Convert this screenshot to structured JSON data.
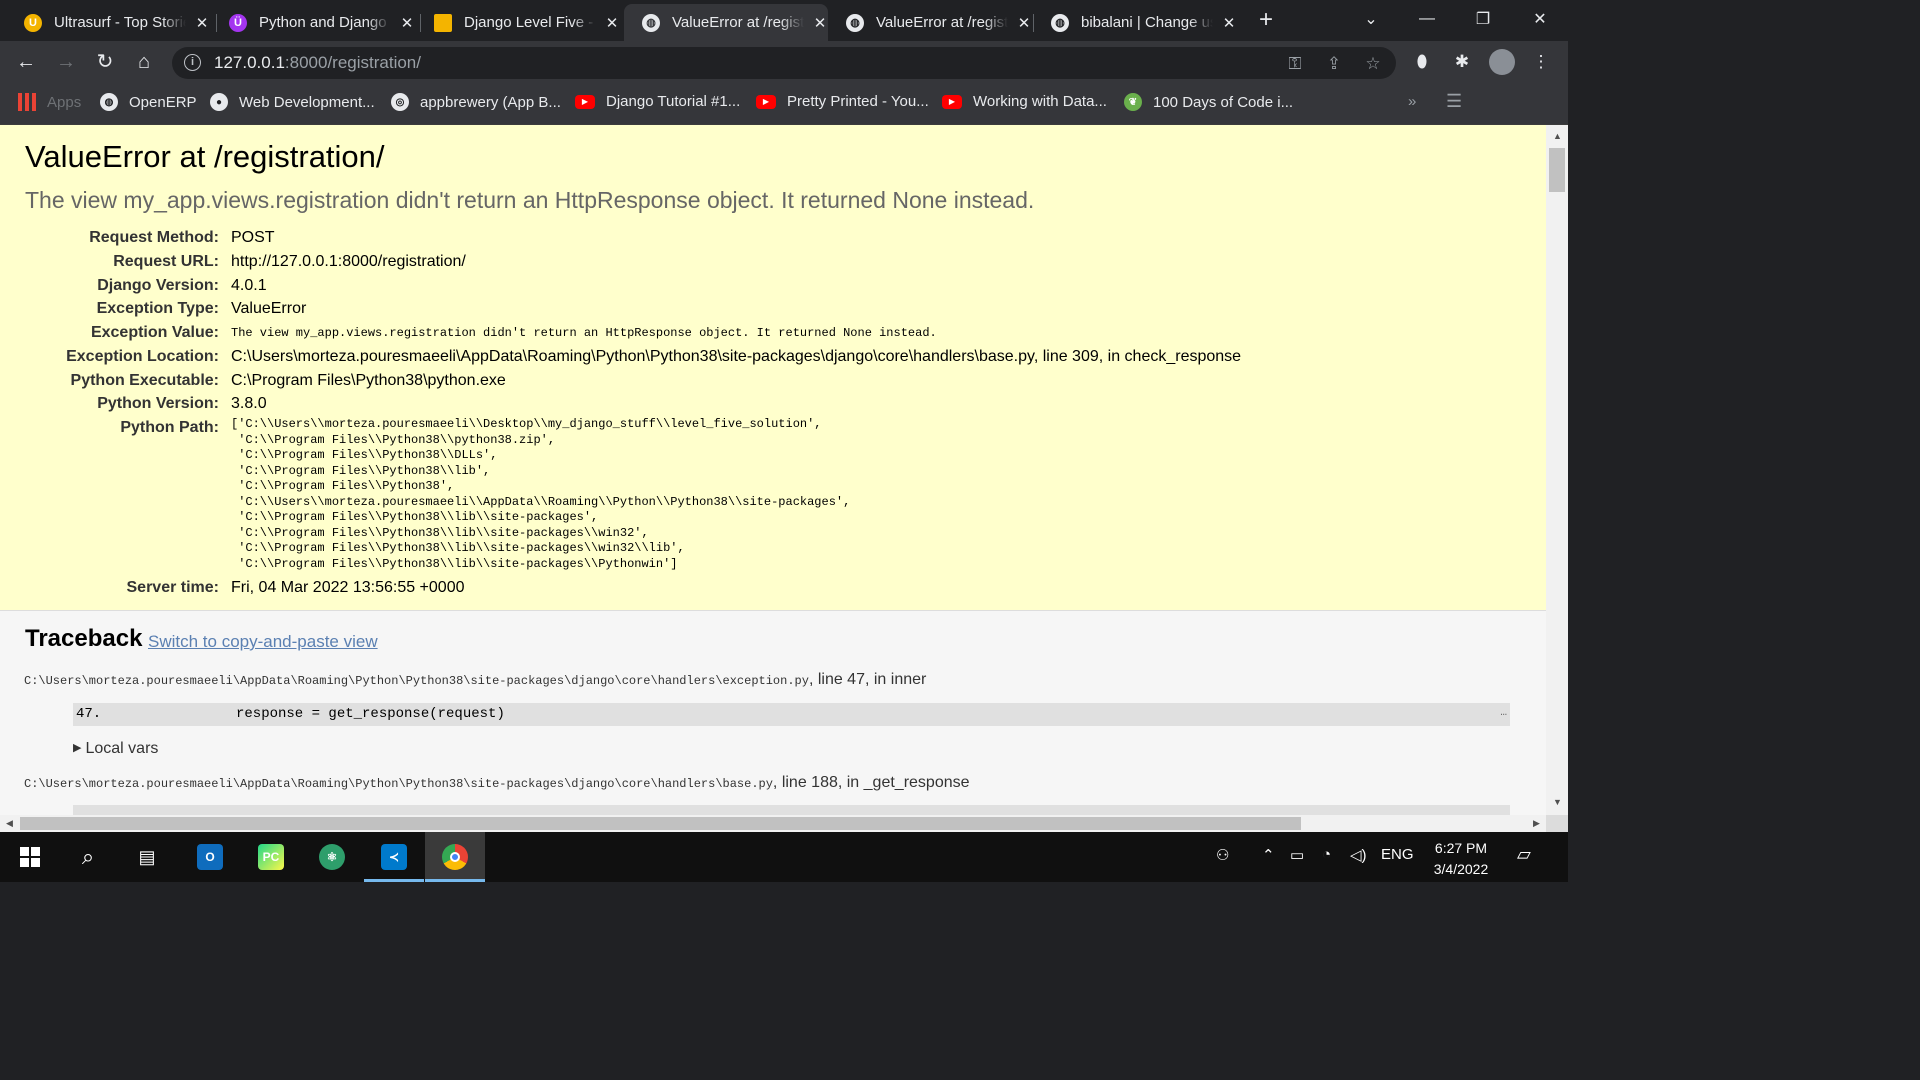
{
  "browser": {
    "tabs": [
      {
        "title": "Ultrasurf - Top Stories",
        "favicon": "ultrasurf-icon",
        "color": "#f4b400"
      },
      {
        "title": "Python and Django Full Stack",
        "favicon": "udemy-icon",
        "color": "#a435f0"
      },
      {
        "title": "Django Level Five - Google Slides",
        "favicon": "slides-icon",
        "color": "#f4b400"
      },
      {
        "title": "ValueError at /registration/",
        "favicon": "globe-icon",
        "color": "#e8eaed"
      },
      {
        "title": "ValueError at /registration/",
        "favicon": "globe-icon",
        "color": "#e8eaed"
      },
      {
        "title": "bibalani | Change user",
        "favicon": "globe-icon",
        "color": "#e8eaed"
      }
    ],
    "active_tab": 3,
    "url_host": "127.0.0.1",
    "url_rest": ":8000/registration/",
    "bookmarks": [
      {
        "label": "Apps",
        "icon": "apps-grid-icon"
      },
      {
        "label": "OpenERP",
        "icon": "globe-icon"
      },
      {
        "label": "Web Development...",
        "icon": "web-dev-icon"
      },
      {
        "label": "appbrewery (App B...",
        "icon": "appbrewery-icon"
      },
      {
        "label": "Django Tutorial #1...",
        "icon": "youtube-icon"
      },
      {
        "label": "Pretty Printed - You...",
        "icon": "youtube-icon"
      },
      {
        "label": "Working with Data...",
        "icon": "youtube-icon"
      },
      {
        "label": "100 Days of Code i...",
        "icon": "leaf-icon"
      }
    ]
  },
  "page": {
    "title": "ValueError at /registration/",
    "subtitle": "The view my_app.views.registration didn't return an HttpResponse object. It returned None instead.",
    "meta": [
      {
        "key": "Request Method:",
        "value": "POST"
      },
      {
        "key": "Request URL:",
        "value": "http://127.0.0.1:8000/registration/"
      },
      {
        "key": "Django Version:",
        "value": "4.0.1"
      },
      {
        "key": "Exception Type:",
        "value": "ValueError"
      },
      {
        "key": "Exception Value:",
        "value": "The view my_app.views.registration didn't return an HttpResponse object. It returned None instead."
      },
      {
        "key": "Exception Location:",
        "value": "C:\\Users\\morteza.pouresmaeeli\\AppData\\Roaming\\Python\\Python38\\site-packages\\django\\core\\handlers\\base.py, line 309, in check_response"
      },
      {
        "key": "Python Executable:",
        "value": "C:\\Program Files\\Python38\\python.exe"
      },
      {
        "key": "Python Version:",
        "value": "3.8.0"
      },
      {
        "key": "Python Path:",
        "value": "['C:\\\\Users\\\\morteza.pouresmaeeli\\\\Desktop\\\\my_django_stuff\\\\level_five_solution',\n 'C:\\\\Program Files\\\\Python38\\\\python38.zip',\n 'C:\\\\Program Files\\\\Python38\\\\DLLs',\n 'C:\\\\Program Files\\\\Python38\\\\lib',\n 'C:\\\\Program Files\\\\Python38',\n 'C:\\\\Users\\\\morteza.pouresmaeeli\\\\AppData\\\\Roaming\\\\Python\\\\Python38\\\\site-packages',\n 'C:\\\\Program Files\\\\Python38\\\\lib\\\\site-packages',\n 'C:\\\\Program Files\\\\Python38\\\\lib\\\\site-packages\\\\win32',\n 'C:\\\\Program Files\\\\Python38\\\\lib\\\\site-packages\\\\win32\\\\lib',\n 'C:\\\\Program Files\\\\Python38\\\\lib\\\\site-packages\\\\Pythonwin']"
      },
      {
        "key": "Server time:",
        "value": "Fri, 04 Mar 2022 13:56:55 +0000"
      }
    ],
    "traceback": {
      "title": "Traceback",
      "switch_link": "Switch to copy-and-paste view",
      "frames": [
        {
          "path": "C:\\Users\\morteza.pouresmaeeli\\AppData\\Roaming\\Python\\Python38\\site-packages\\django\\core\\handlers\\exception.py",
          "loc": ", line 47, in inner",
          "line_no": "47.",
          "code": "response = get_response(request)",
          "dots": "…",
          "local_vars": "Local vars"
        },
        {
          "path": "C:\\Users\\morteza.pouresmaeeli\\AppData\\Roaming\\Python\\Python38\\site-packages\\django\\core\\handlers\\base.py",
          "loc": ", line 188, in _get_response"
        }
      ]
    }
  },
  "taskbar": {
    "apps": [
      "windows-start-icon",
      "search-icon",
      "task-view-icon",
      "outlook-icon",
      "pycharm-icon",
      "atom-icon",
      "vscode-icon",
      "chrome-icon"
    ],
    "language": "ENG",
    "time": "6:27 PM",
    "date": "3/4/2022"
  }
}
